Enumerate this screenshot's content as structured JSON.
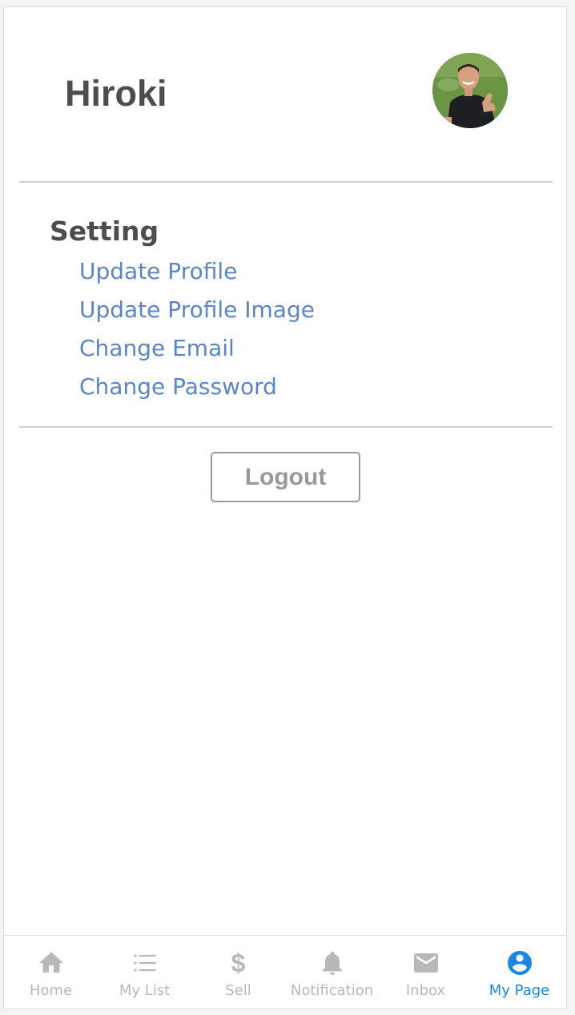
{
  "profile": {
    "name": "Hiroki",
    "avatar_icon": "user-photo"
  },
  "settings": {
    "title": "Setting",
    "items": [
      {
        "label": "Update Profile"
      },
      {
        "label": "Update Profile Image"
      },
      {
        "label": "Change Email"
      },
      {
        "label": "Change Password"
      }
    ]
  },
  "logout": {
    "label": "Logout"
  },
  "tabbar": {
    "active": "My Page",
    "active_color": "#1a87e5",
    "inactive_color": "#b8b8b8",
    "tabs": [
      {
        "label": "Home",
        "icon": "home-icon"
      },
      {
        "label": "My List",
        "icon": "list-icon"
      },
      {
        "label": "Sell",
        "icon": "dollar-icon",
        "glyph": "$"
      },
      {
        "label": "Notification",
        "icon": "bell-icon"
      },
      {
        "label": "Inbox",
        "icon": "mail-icon"
      },
      {
        "label": "My Page",
        "icon": "user-circle-icon"
      }
    ]
  },
  "colors": {
    "link": "#5b85c9",
    "heading": "#4d4d4d",
    "divider": "#cfcfcf"
  }
}
